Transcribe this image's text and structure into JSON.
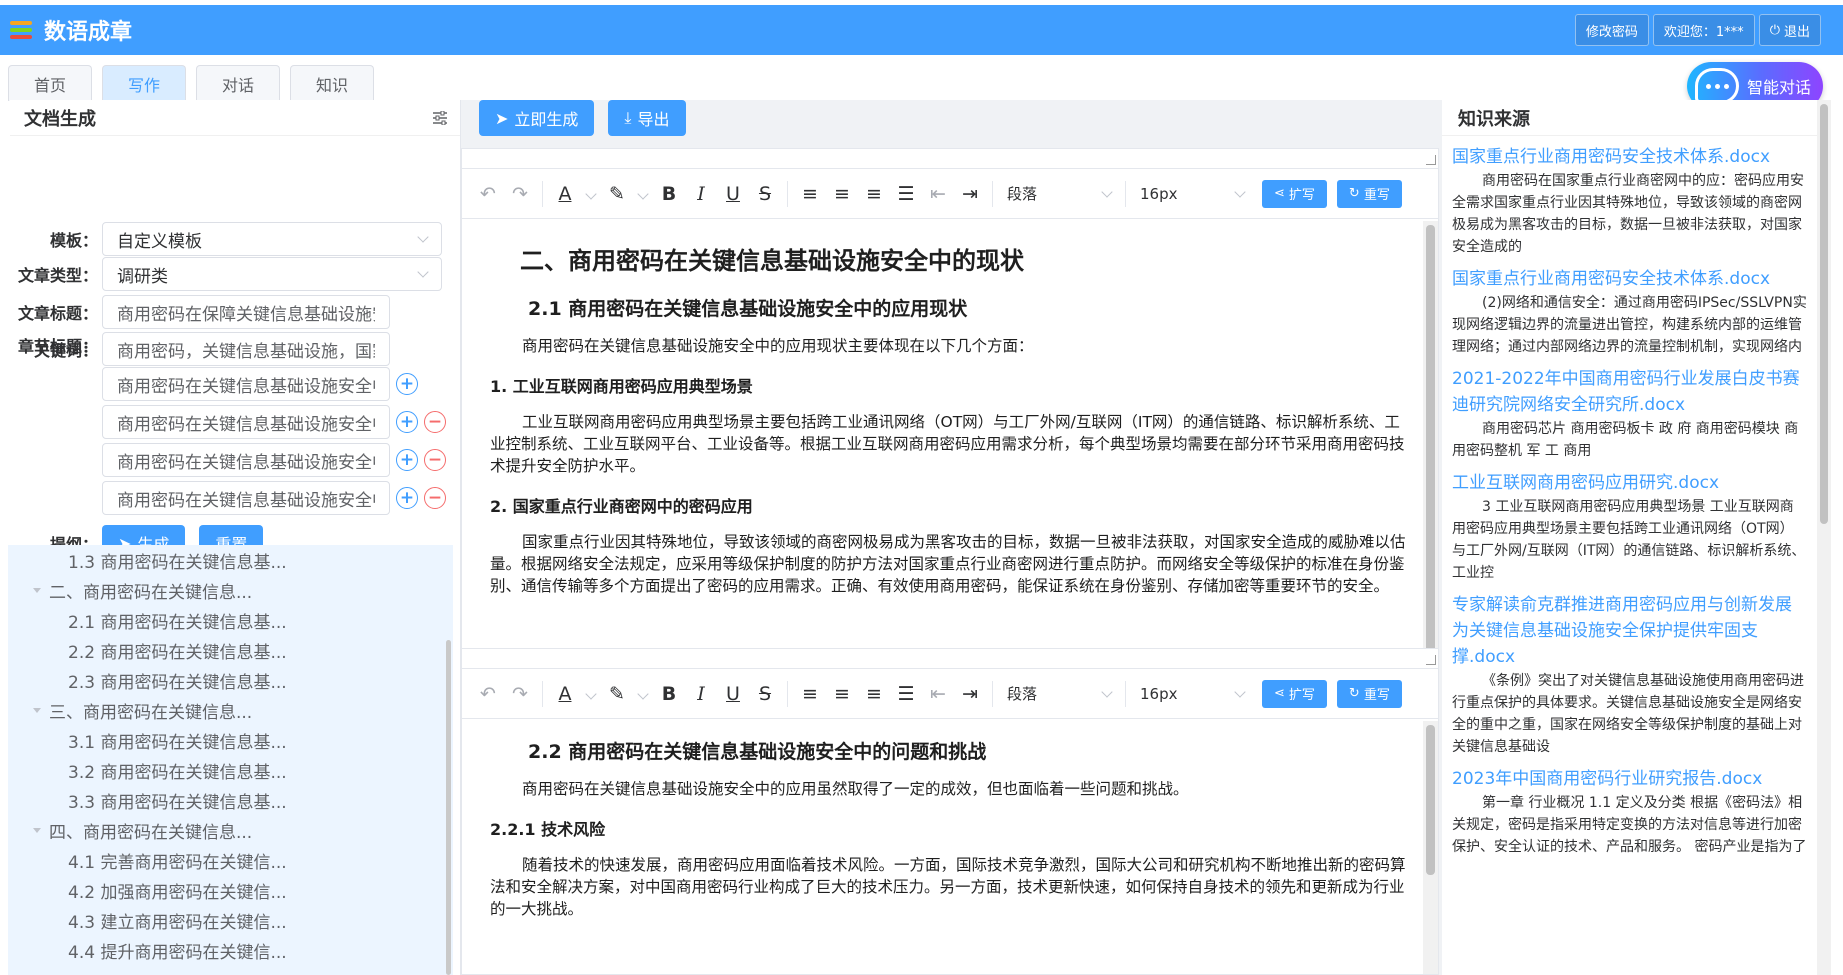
{
  "app": {
    "title": "数语成章"
  },
  "header": {
    "change_password": "修改密码",
    "welcome": "欢迎您：1***",
    "logout": "退出"
  },
  "tabs": [
    {
      "label": "首页"
    },
    {
      "label": "写作"
    },
    {
      "label": "对话"
    },
    {
      "label": "知识"
    }
  ],
  "chat_fab": {
    "label": "智能对话"
  },
  "left": {
    "title": "文档生成",
    "template": {
      "label": "模板：",
      "value": "自定义模板"
    },
    "type": {
      "label": "文章类型：",
      "value": "调研类"
    },
    "doc_title": {
      "label": "文章标题：",
      "value": "商用密码在保障关键信息基础设施安全中的作用"
    },
    "keywords": {
      "label": "关键词：",
      "value": "商用密码，关键信息基础设施，国家安全"
    },
    "chapter_label": "章节标题：",
    "chapters": [
      "商用密码在关键信息基础设施安全中的作用",
      "商用密码在关键信息基础设施安全中的现状",
      "商用密码在关键信息基础设施安全中的挑战",
      "商用密码在关键信息基础设施安全中的对策"
    ],
    "outline_label": "提纲：",
    "generate": "生成",
    "reset": "重置",
    "outline": [
      {
        "level": 2,
        "text": "1.3 商用密码在关键信息基..."
      },
      {
        "level": 1,
        "text": "二、商用密码在关键信息..."
      },
      {
        "level": 2,
        "text": "2.1 商用密码在关键信息基..."
      },
      {
        "level": 2,
        "text": "2.2 商用密码在关键信息基..."
      },
      {
        "level": 2,
        "text": "2.3 商用密码在关键信息基..."
      },
      {
        "level": 1,
        "text": "三、商用密码在关键信息..."
      },
      {
        "level": 2,
        "text": "3.1 商用密码在关键信息基..."
      },
      {
        "level": 2,
        "text": "3.2 商用密码在关键信息基..."
      },
      {
        "level": 2,
        "text": "3.3 商用密码在关键信息基..."
      },
      {
        "level": 1,
        "text": "四、商用密码在关键信息..."
      },
      {
        "level": 2,
        "text": "4.1 完善商用密码在关键信..."
      },
      {
        "level": 2,
        "text": "4.2 加强商用密码在关键信..."
      },
      {
        "level": 2,
        "text": "4.3 建立商用密码在关键信..."
      },
      {
        "level": 2,
        "text": "4.4 提升商用密码在关键信..."
      }
    ]
  },
  "center": {
    "generate_now": "立即生成",
    "export": "导出",
    "toolbar": {
      "paragraph": "段落",
      "font_size": "16px",
      "expand": "扩写",
      "rewrite": "重写"
    },
    "editor1": {
      "h1": "二、商用密码在关键信息基础设施安全中的现状",
      "h2": "2.1 商用密码在关键信息基础设施安全中的应用现状",
      "p1": "商用密码在关键信息基础设施安全中的应用现状主要体现在以下几个方面：",
      "h3a": "1. 工业互联网商用密码应用典型场景",
      "p2": "工业互联网商用密码应用典型场景主要包括跨工业通讯网络（OT网）与工厂外网/互联网（IT网）的通信链路、标识解析系统、工业控制系统、工业互联网平台、工业设备等。根据工业互联网商用密码应用需求分析，每个典型场景均需要在部分环节采用商用密码技术提升安全防护水平。",
      "h3b": "2. 国家重点行业商密网中的密码应用",
      "p3": "国家重点行业因其特殊地位，导致该领域的商密网极易成为黑客攻击的目标，数据一旦被非法获取，对国家安全造成的威胁难以估量。根据网络安全法规定，应采用等级保护制度的防护方法对国家重点行业商密网进行重点防护。而网络安全等级保护的标准在身份鉴别、通信传输等多个方面提出了密码的应用需求。正确、有效使用商用密码，能保证系统在身份鉴别、存储加密等重要环节的安全。"
    },
    "editor2": {
      "h2": "2.2 商用密码在关键信息基础设施安全中的问题和挑战",
      "p1": "商用密码在关键信息基础设施安全中的应用虽然取得了一定的成效，但也面临着一些问题和挑战。",
      "h3": "2.2.1 技术风险",
      "p2": "随着技术的快速发展，商用密码应用面临着技术风险。一方面，国际技术竞争激烈，国际大公司和研究机构不断地推出新的密码算法和安全解决方案，对中国商用密码行业构成了巨大的技术压力。另一方面，技术更新快速，如何保持自身技术的领先和更新成为行业的一大挑战。"
    }
  },
  "right": {
    "title": "知识来源",
    "sources": [
      {
        "title": "国家重点行业商用密码安全技术体系.docx",
        "snippet": "商用密码在国家重点行业商密网中的应：密码应用安全需求国家重点行业因其特殊地位，导致该领域的商密网极易成为黑客攻击的目标，数据一旦被非法获取，对国家安全造成的"
      },
      {
        "title": "国家重点行业商用密码安全技术体系.docx",
        "snippet": "(2)网络和通信安全：通过商用密码IPSec/SSLVPN实现网络逻辑边界的流量进出管控，构建系统内部的运维管理网络；通过内部网络边界的流量控制机制，实现网络内"
      },
      {
        "title": "2021-2022年中国商用密码行业发展白皮书赛迪研究院网络安全研究所.docx",
        "snippet": "商用密码芯片 商用密码板卡 政 府 商用密码模块 商用密码整机 军 工 商用"
      },
      {
        "title": "工业互联网商用密码应用研究.docx",
        "snippet": "3 工业互联网商用密码应用典型场景 工业互联网商用密码应用典型场景主要包括跨工业通讯网络（OT网）与工厂外网/互联网（IT网）的通信链路、标识解析系统、工业控"
      },
      {
        "title": "专家解读俞克群推进商用密码应用与创新发展为关键信息基础设施安全保护提供牢固支撑.docx",
        "snippet": "《条例》突出了对关键信息基础设施使用商用密码进行重点保护的具体要求。关键信息基础设施安全是网络安全的重中之重，国家在网络安全等级保护制度的基础上对关键信息基础设"
      },
      {
        "title": "2023年中国商用密码行业研究报告.docx",
        "snippet": "第一章 行业概况 1.1 定义及分类 根据《密码法》相关规定，密码是指采用特定变换的方法对信息等进行加密保护、安全认证的技术、产品和服务。 密码产业是指为了"
      }
    ]
  },
  "colors": {
    "primary": "#409eff",
    "danger": "#f56c6c",
    "outline_bg": "#ecf5ff"
  }
}
